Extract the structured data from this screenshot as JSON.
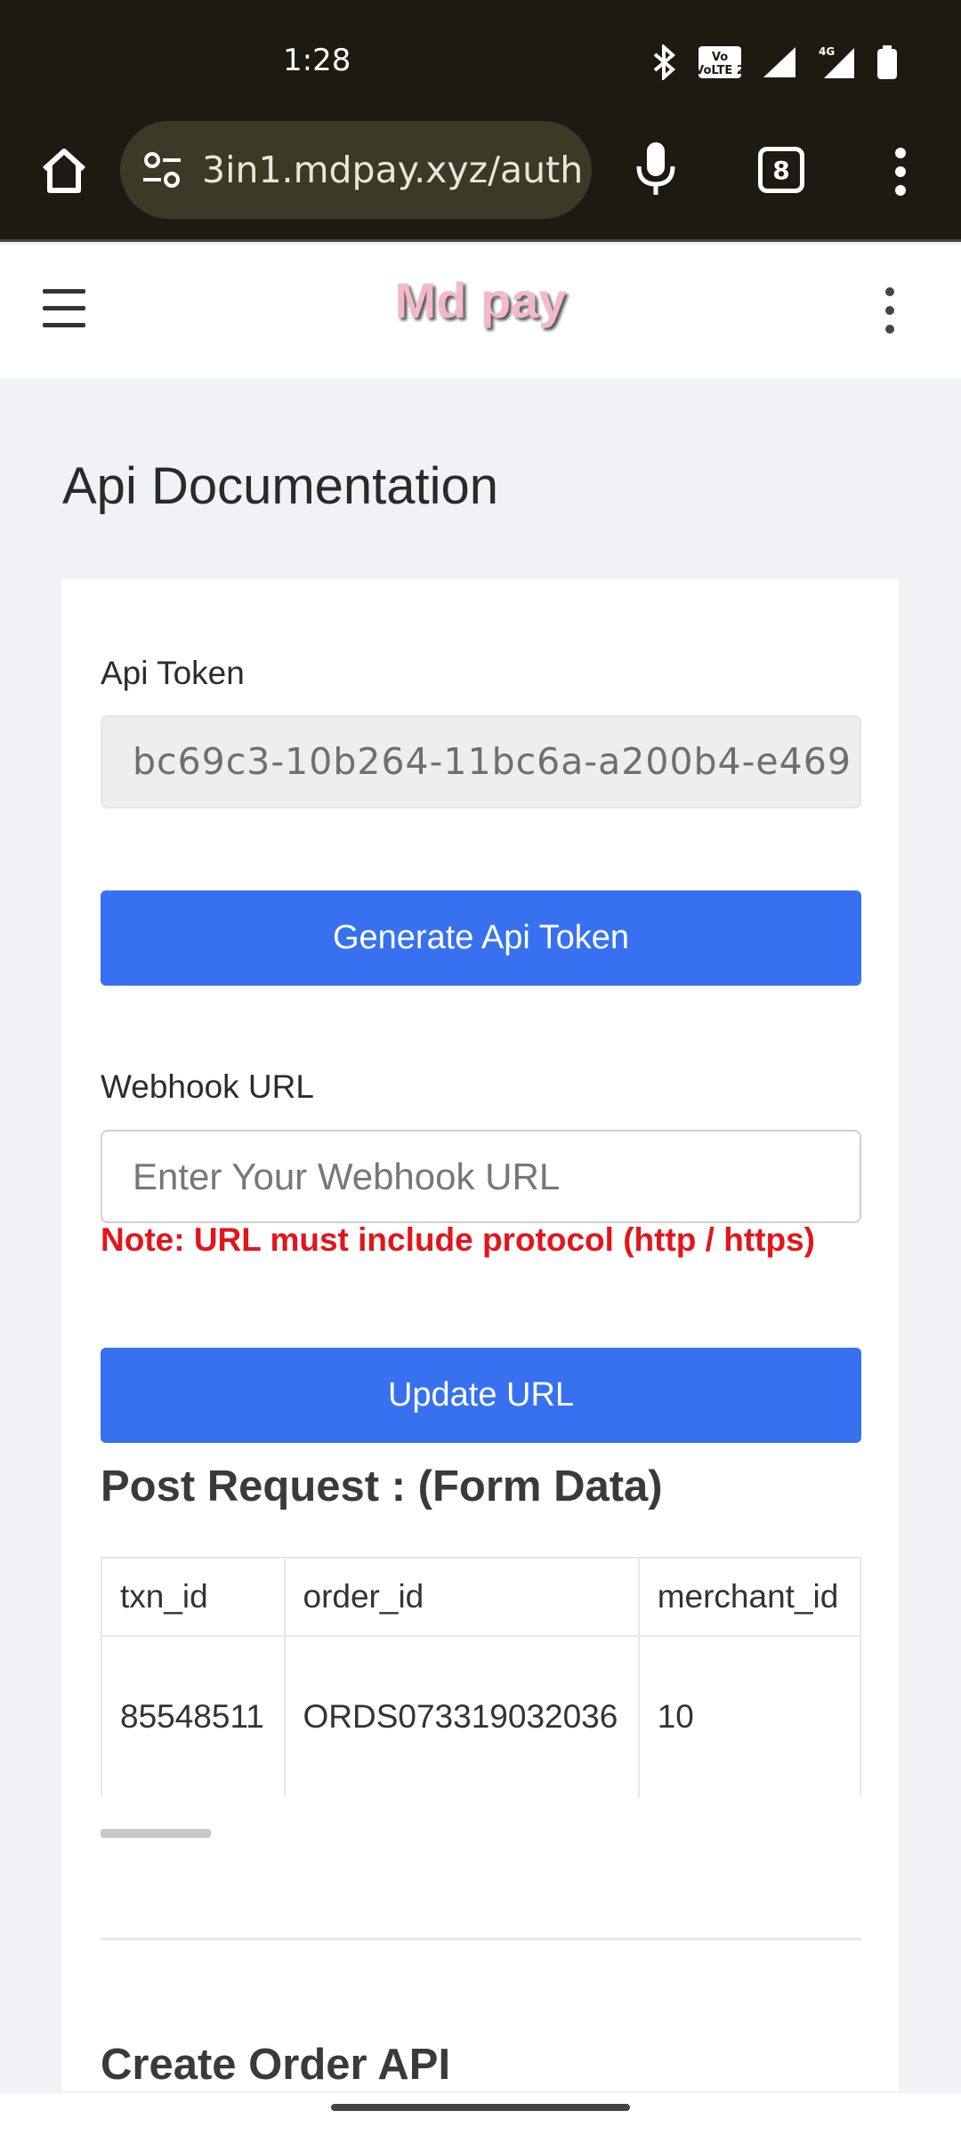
{
  "status_bar": {
    "time": "1:28",
    "network_badge": "4G",
    "volte": "VoLTE 2"
  },
  "browser": {
    "url": "3in1.mdpay.xyz/auth",
    "tab_count": "8"
  },
  "site": {
    "logo": "Md pay"
  },
  "page": {
    "title": "Api Documentation"
  },
  "api_token": {
    "label": "Api Token",
    "value": "bc69c3-10b264-11bc6a-a200b4-e469"
  },
  "generate_button": {
    "label": "Generate Api Token"
  },
  "webhook": {
    "label": "Webhook URL",
    "placeholder": "Enter Your Webhook URL",
    "note": "Note: URL must include protocol (http / https)"
  },
  "update_button": {
    "label": "Update URL"
  },
  "post_request": {
    "title": "Post Request : (Form Data)",
    "headers": [
      "txn_id",
      "order_id",
      "merchant_id"
    ],
    "rows": [
      [
        "85548511",
        "ORDS073319032036",
        "10"
      ]
    ]
  },
  "create_order": {
    "title": "Create Order API"
  },
  "colors": {
    "accent": "#3771ef",
    "error": "#e3151b",
    "browser_bar": "#1d1b11"
  }
}
